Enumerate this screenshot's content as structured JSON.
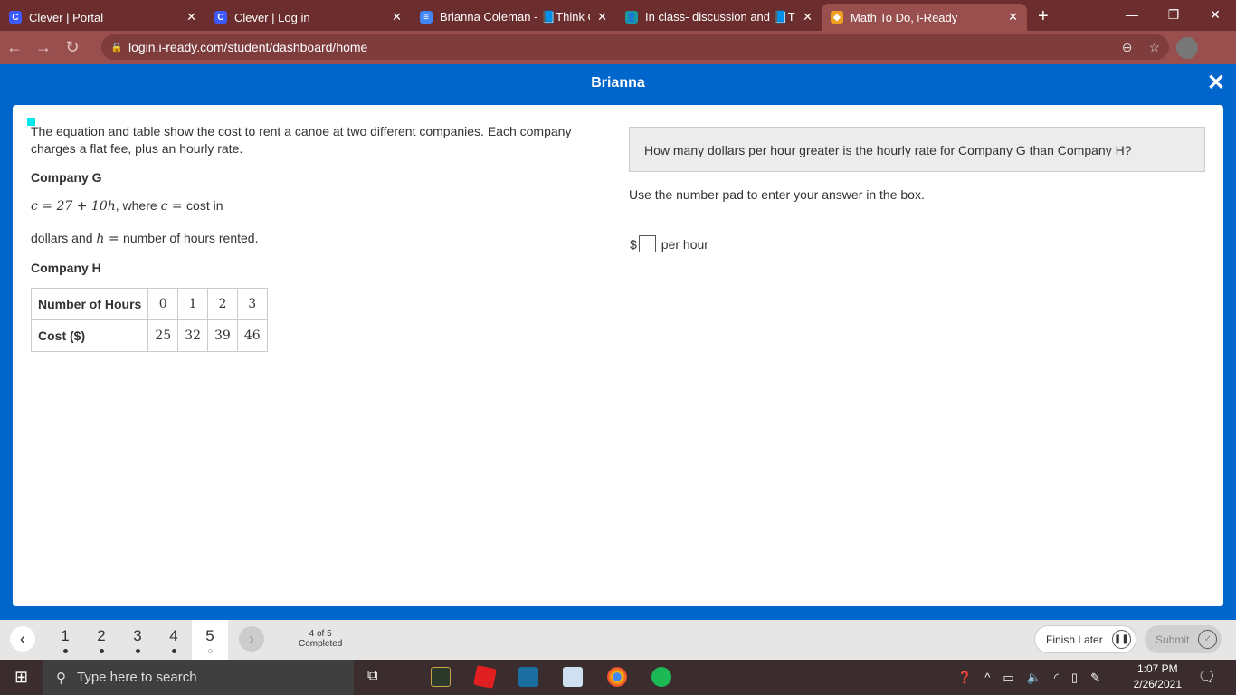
{
  "browser": {
    "tabs": [
      {
        "label": "Clever | Portal",
        "icon": "C"
      },
      {
        "label": "Clever | Log in",
        "icon": "C"
      },
      {
        "label": "Brianna Coleman - 📘Think Qu",
        "icon": "≡"
      },
      {
        "label": "In class- discussion and 📘Think",
        "icon": "👤"
      },
      {
        "label": "Math To Do, i-Ready",
        "icon": "◆"
      }
    ],
    "new_tab": "+",
    "url": "login.i-ready.com/student/dashboard/home"
  },
  "header": {
    "title": "Brianna",
    "close": "✕"
  },
  "problem": {
    "intro": "The equation and table show the cost to rent a canoe at two different companies. Each company charges a flat fee, plus an hourly rate.",
    "company_g": "Company G",
    "eq_math": "c = 27 + 10h",
    "eq_text": ", where ",
    "c_var": "c = ",
    "eq_cost": "cost in",
    "line2_a": "dollars and ",
    "h_var": "h = ",
    "line2_b": "number of hours rented.",
    "company_h": "Company H",
    "table": {
      "row1_label": "Number of Hours",
      "hours": [
        "0",
        "1",
        "2",
        "3"
      ],
      "row2_label": "Cost ($)",
      "costs": [
        "25",
        "32",
        "39",
        "46"
      ]
    }
  },
  "question": {
    "text": "How many dollars per hour greater is the hourly rate for Company G than Company H?",
    "instruction": "Use the number pad to enter your answer in the box.",
    "prefix": "$",
    "suffix": "per hour",
    "answer": ""
  },
  "footer": {
    "pages": [
      "1",
      "2",
      "3",
      "4",
      "5"
    ],
    "progress_count": "4 of 5",
    "progress_label": "Completed",
    "finish_later": "Finish Later",
    "submit": "Submit"
  },
  "taskbar": {
    "search_placeholder": "Type here to search",
    "time": "1:07 PM",
    "date": "2/26/2021"
  }
}
